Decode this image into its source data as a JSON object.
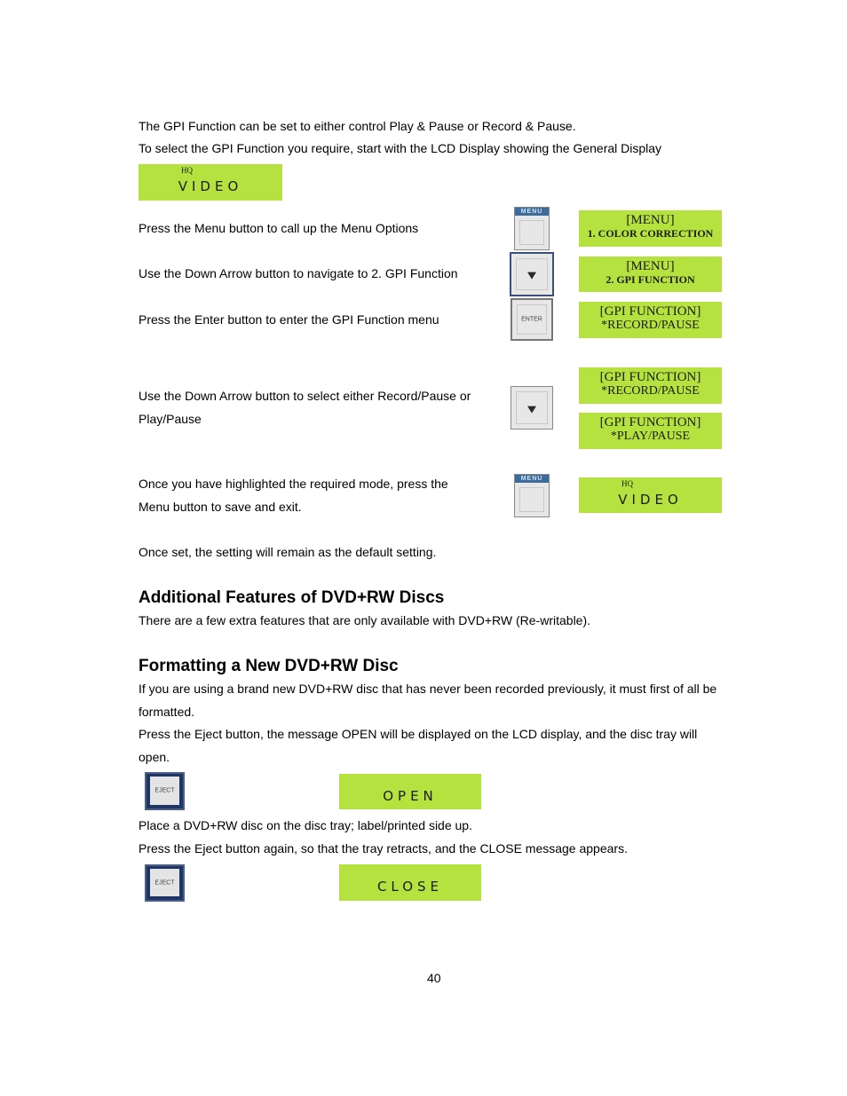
{
  "intro": {
    "line1": "The GPI Function can be set to either control Play & Pause or Record & Pause.",
    "line2": "To select the GPI Function you require, start with the LCD Display showing the General Display"
  },
  "general_display": {
    "hq": "HQ",
    "word": "VIDEO"
  },
  "steps": [
    {
      "text": "Press the Menu button to call up the Menu Options",
      "button": "MENU",
      "lcd_line1": "[MENU]",
      "lcd_line2": "1. COLOR CORRECTION"
    },
    {
      "text": "Use the Down Arrow button to navigate to 2. GPI Function",
      "button": "down-arrow",
      "lcd_line1": "[MENU]",
      "lcd_line2": "2. GPI FUNCTION"
    },
    {
      "text": "Press the Enter button to enter the GPI Function menu",
      "button": "ENTER",
      "lcd_line1": "[GPI FUNCTION]",
      "lcd_line2": "*RECORD/PAUSE"
    },
    {
      "text_line1": "Use the Down Arrow button to select either Record/Pause or",
      "text_line2": "Play/Pause",
      "button": "down-arrow",
      "lcd_a_line1": "[GPI FUNCTION]",
      "lcd_a_line2": "*RECORD/PAUSE",
      "lcd_b_line1": "[GPI FUNCTION]",
      "lcd_b_line2": "*PLAY/PAUSE"
    },
    {
      "text_line1": "Once you have highlighted the required mode, press the",
      "text_line2": "Menu button to save and exit.",
      "button": "MENU",
      "lcd_hq": "HQ",
      "lcd_word": "VIDEO"
    }
  ],
  "default_note": "Once set, the setting will remain as the default setting.",
  "section1": {
    "heading": "Additional Features of DVD+RW Discs",
    "body": "There are a few extra features that are only available with DVD+RW (Re-writable)."
  },
  "section2": {
    "heading": "Formatting a New DVD+RW Disc",
    "p1_line1": "If you are using a brand new DVD+RW disc that has never been recorded previously, it must first of all be",
    "p1_line2": "formatted.",
    "p2_line1": "Press the Eject button, the message OPEN will be displayed on the LCD display, and the disc tray will",
    "p2_line2": "open.",
    "eject_label": "EJECT",
    "lcd_open": "OPEN",
    "p3": "Place a DVD+RW disc on the disc tray; label/printed side up.",
    "p4": "Press the Eject button again, so that the tray retracts, and the CLOSE message appears.",
    "lcd_close": "CLOSE"
  },
  "page_number": "40"
}
